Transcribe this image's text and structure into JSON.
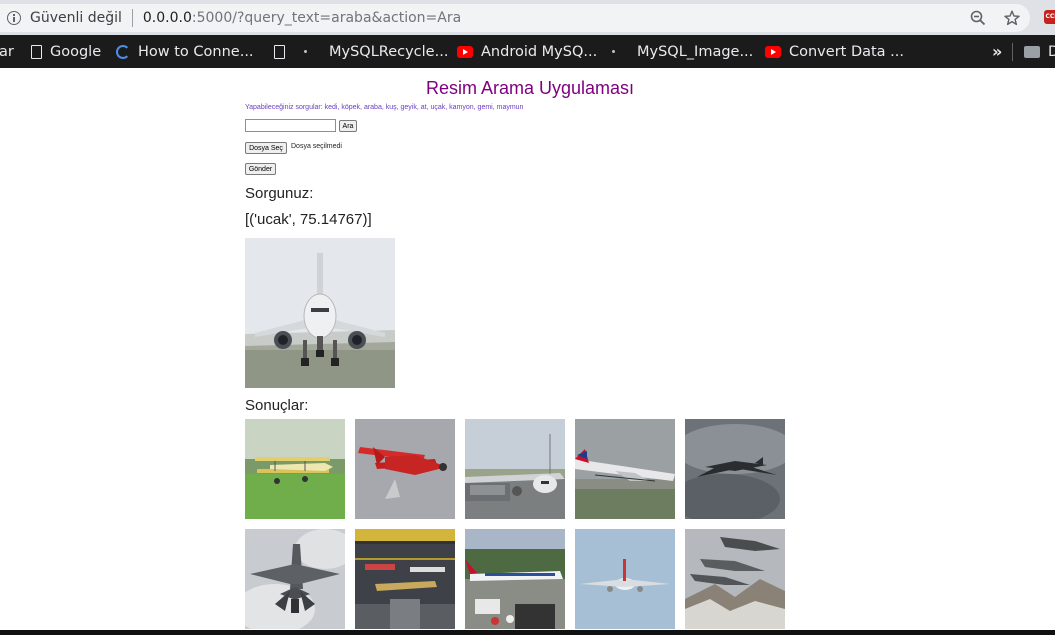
{
  "browser": {
    "security_label": "Güvenli değil",
    "url_host": "0.0.0.0",
    "url_rest": ":5000/?query_text=araba&action=Ara",
    "extension_badge": "CCI",
    "bookmarks": [
      {
        "label": "ar",
        "icon": "none"
      },
      {
        "label": "Google",
        "icon": "page-icon"
      },
      {
        "label": "How to Conne...",
        "icon": "swirl-icon"
      },
      {
        "label": "",
        "icon": "page-icon"
      },
      {
        "label": "MySQLRecycle...",
        "icon": "dot-icon"
      },
      {
        "label": "Android MySQ...",
        "icon": "youtube-icon"
      },
      {
        "label": "MySQL_Image...",
        "icon": "dot-icon"
      },
      {
        "label": "Convert Data ...",
        "icon": "youtube-icon"
      }
    ],
    "overflow_label": "»",
    "folder_label": "D"
  },
  "page": {
    "title": "Resim Arama Uygulaması",
    "hint": "Yapabileceğiniz sorgular: kedi, köpek, araba, kuş, geyik, at, uçak, kamyon, gemi, maymun",
    "search_value": "",
    "search_button": "Ara",
    "file_button": "Dosya Seç",
    "file_status": "Dosya seçilmedi",
    "submit_button": "Gönder",
    "query_label": "Sorgunuz:",
    "query_result": "[('ucak', 75.14767)]",
    "results_label": "Sonuçlar:",
    "results": [
      {
        "subject": "yellow-biplane"
      },
      {
        "subject": "red-biplane"
      },
      {
        "subject": "airliner-on-tarmac"
      },
      {
        "subject": "british-airways-landing"
      },
      {
        "subject": "airliner-in-sky"
      },
      {
        "subject": "fighter-jet-clouds"
      },
      {
        "subject": "museum-hangar"
      },
      {
        "subject": "airliner-on-airfield"
      },
      {
        "subject": "airliner-approach"
      },
      {
        "subject": "fighter-jets-mountains"
      }
    ]
  }
}
